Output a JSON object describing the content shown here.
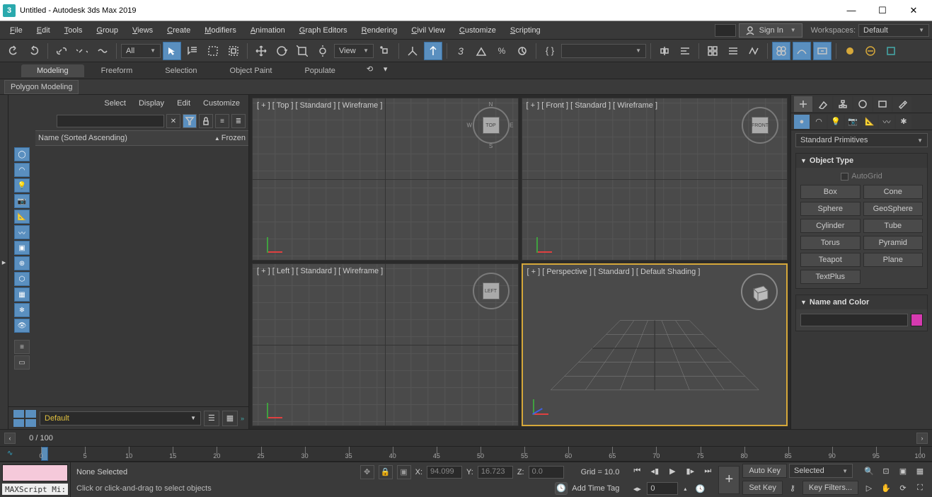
{
  "title": "Untitled - Autodesk 3ds Max 2019",
  "app_icon": "3",
  "window_controls": {
    "min": "—",
    "max": "☐",
    "close": "✕"
  },
  "menu": [
    "File",
    "Edit",
    "Tools",
    "Group",
    "Views",
    "Create",
    "Modifiers",
    "Animation",
    "Graph Editors",
    "Rendering",
    "Civil View",
    "Customize",
    "Scripting"
  ],
  "signin_label": "Sign In",
  "workspaces_label": "Workspaces:",
  "workspace_selected": "Default",
  "toolbar": {
    "selection_filter": "All",
    "ref_coord": "View"
  },
  "ribbon_tabs": [
    "Modeling",
    "Freeform",
    "Selection",
    "Object Paint",
    "Populate"
  ],
  "ribbon_sub": "Polygon Modeling",
  "scene_explorer": {
    "menu": [
      "Select",
      "Display",
      "Edit",
      "Customize"
    ],
    "col_name": "Name (Sorted Ascending)",
    "col_frozen": "Frozen",
    "layer_selected": "Default"
  },
  "viewports": [
    {
      "label": "[ + ] [ Top ] [ Standard ] [ Wireframe ]",
      "cube": "TOP",
      "compass": true
    },
    {
      "label": "[ + ] [ Front ] [ Standard ] [ Wireframe ]",
      "cube": "FRONT"
    },
    {
      "label": "[ + ] [ Left ] [ Standard ] [ Wireframe ]",
      "cube": "LEFT"
    },
    {
      "label": "[ + ] [ Perspective ] [ Standard ] [ Default Shading ]",
      "cube": ""
    }
  ],
  "cmd_panel": {
    "category": "Standard Primitives",
    "rollout1": "Object Type",
    "autogrid": "AutoGrid",
    "buttons": [
      "Box",
      "Cone",
      "Sphere",
      "GeoSphere",
      "Cylinder",
      "Tube",
      "Torus",
      "Pyramid",
      "Teapot",
      "Plane",
      "TextPlus"
    ],
    "rollout2": "Name and Color",
    "color_swatch": "#d63ab0"
  },
  "track": {
    "frame_label": "0 / 100"
  },
  "timeline": {
    "start": 0,
    "end": 100,
    "major_step": 5
  },
  "status": {
    "maxscript": "MAXScript Mi:",
    "selection": "None Selected",
    "hint": "Click or click-and-drag to select objects",
    "coords": {
      "x_label": "X:",
      "x_val": "94.099",
      "y_label": "Y:",
      "y_val": "16.723",
      "z_label": "Z:",
      "z_val": "0.0"
    },
    "grid_label": "Grid = 10.0",
    "time_tag": "Add Time Tag",
    "autokey": "Auto Key",
    "setkey": "Set Key",
    "keymode_selected": "Selected",
    "keyfilters": "Key Filters...",
    "frame_spinner": "0"
  }
}
